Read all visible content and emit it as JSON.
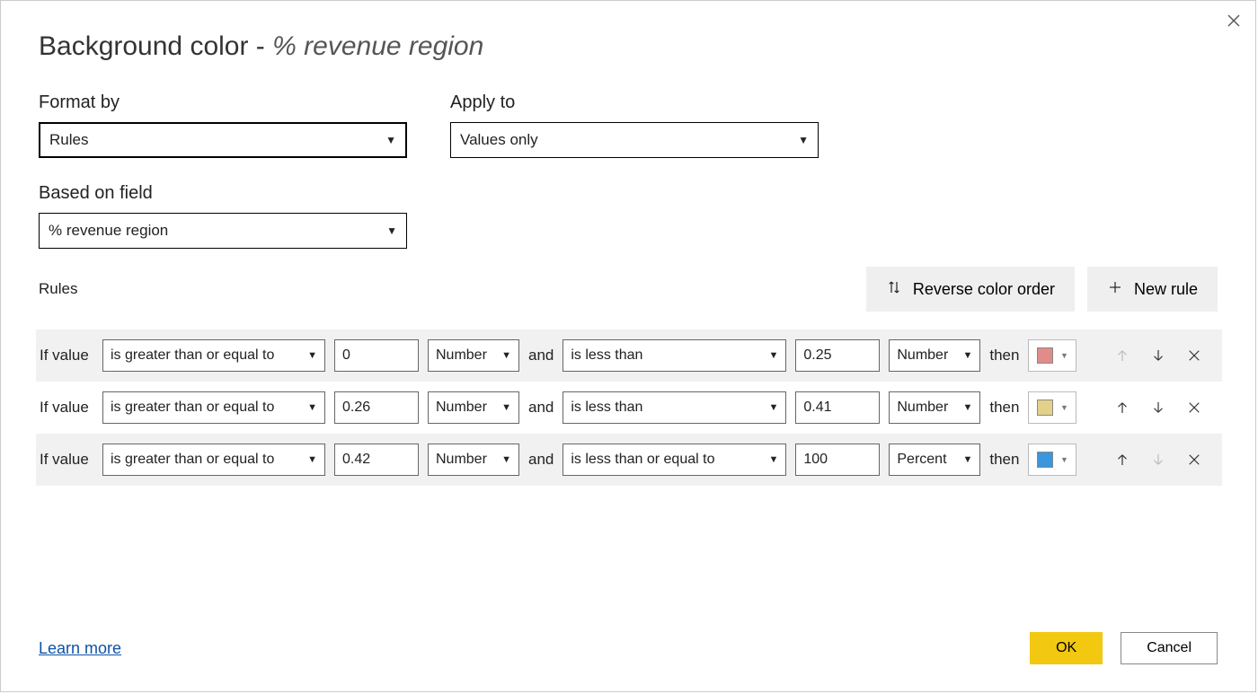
{
  "dialog": {
    "title_prefix": "Background color - ",
    "title_field": "% revenue region"
  },
  "labels": {
    "format_by": "Format by",
    "apply_to": "Apply to",
    "based_on_field": "Based on field",
    "rules": "Rules",
    "if_value": "If value",
    "and": "and",
    "then": "then",
    "learn_more": "Learn more"
  },
  "selects": {
    "format_by": "Rules",
    "apply_to": "Values only",
    "based_on_field": "% revenue region"
  },
  "buttons": {
    "reverse_color_order": "Reverse color order",
    "new_rule": "New rule",
    "ok": "OK",
    "cancel": "Cancel"
  },
  "rules": [
    {
      "op1": "is greater than or equal to",
      "val1": "0",
      "type1": "Number",
      "op2": "is less than",
      "val2": "0.25",
      "type2": "Number",
      "color": "#e18b8b",
      "up_enabled": false,
      "down_enabled": true
    },
    {
      "op1": "is greater than or equal to",
      "val1": "0.26",
      "type1": "Number",
      "op2": "is less than",
      "val2": "0.41",
      "type2": "Number",
      "color": "#e3d18a",
      "up_enabled": true,
      "down_enabled": true
    },
    {
      "op1": "is greater than or equal to",
      "val1": "0.42",
      "type1": "Number",
      "op2": "is less than or equal to",
      "val2": "100",
      "type2": "Percent",
      "color": "#3a96dd",
      "up_enabled": true,
      "down_enabled": false
    }
  ]
}
